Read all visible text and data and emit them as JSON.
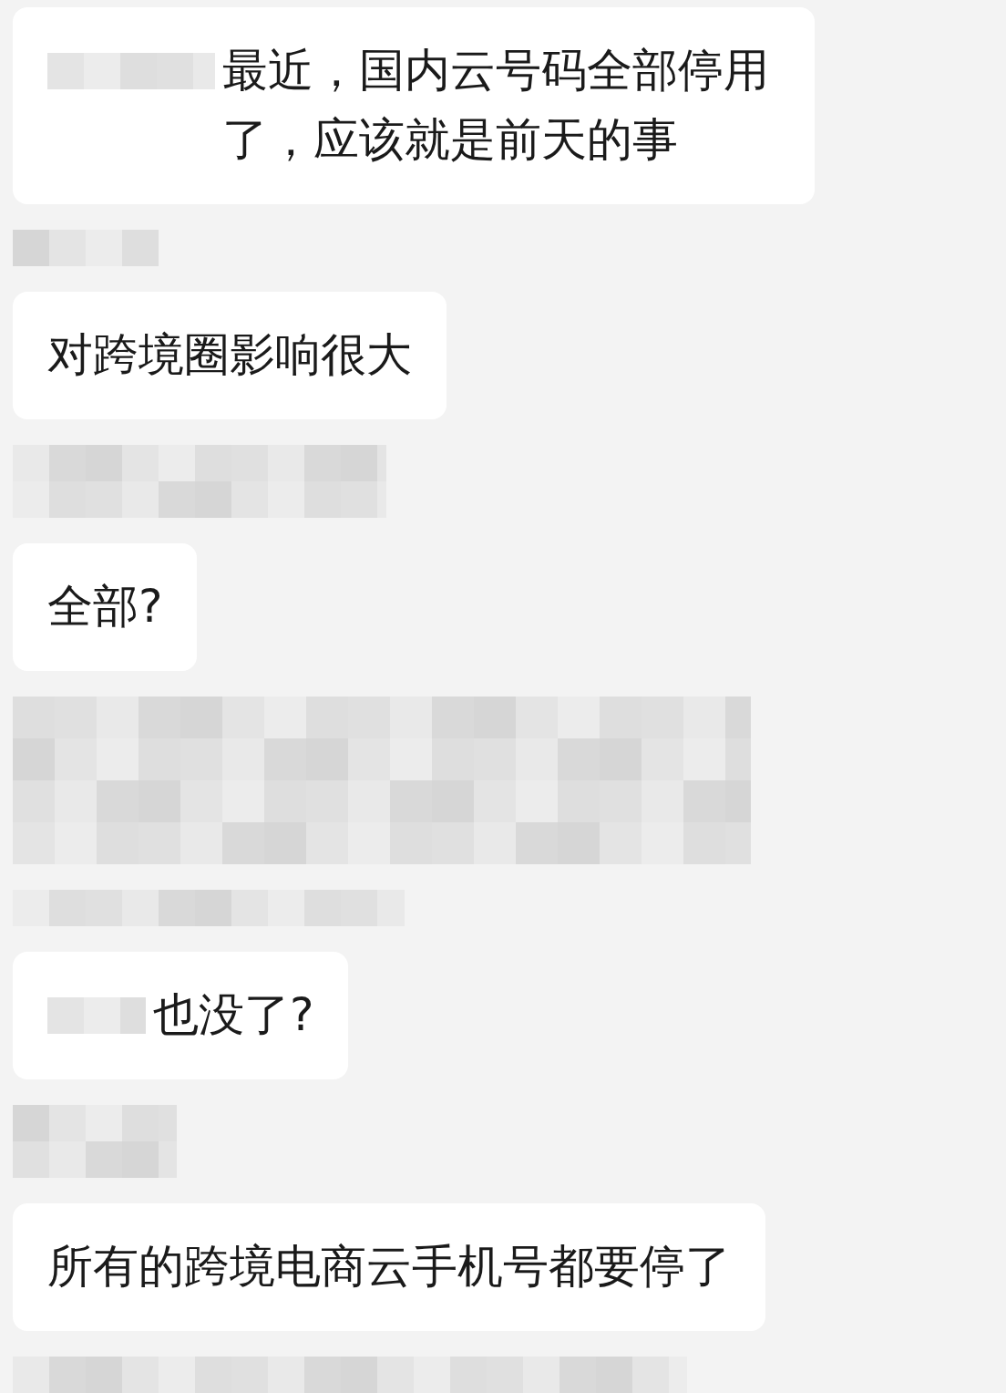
{
  "messages": [
    {
      "kind": "text",
      "redacted_prefix": true,
      "text": "最近，国内云号码全部停用了，应该就是前天的事"
    },
    {
      "kind": "redacted"
    },
    {
      "kind": "text",
      "redacted_prefix": false,
      "text": "对跨境圈影响很大"
    },
    {
      "kind": "redacted"
    },
    {
      "kind": "text",
      "redacted_prefix": false,
      "text": "全部?"
    },
    {
      "kind": "redacted_bubble"
    },
    {
      "kind": "redacted"
    },
    {
      "kind": "text",
      "redacted_prefix": true,
      "text": "也没了?"
    },
    {
      "kind": "redacted"
    },
    {
      "kind": "text",
      "redacted_prefix": false,
      "text": "所有的跨境电商云手机号都要停了"
    },
    {
      "kind": "redacted"
    }
  ]
}
